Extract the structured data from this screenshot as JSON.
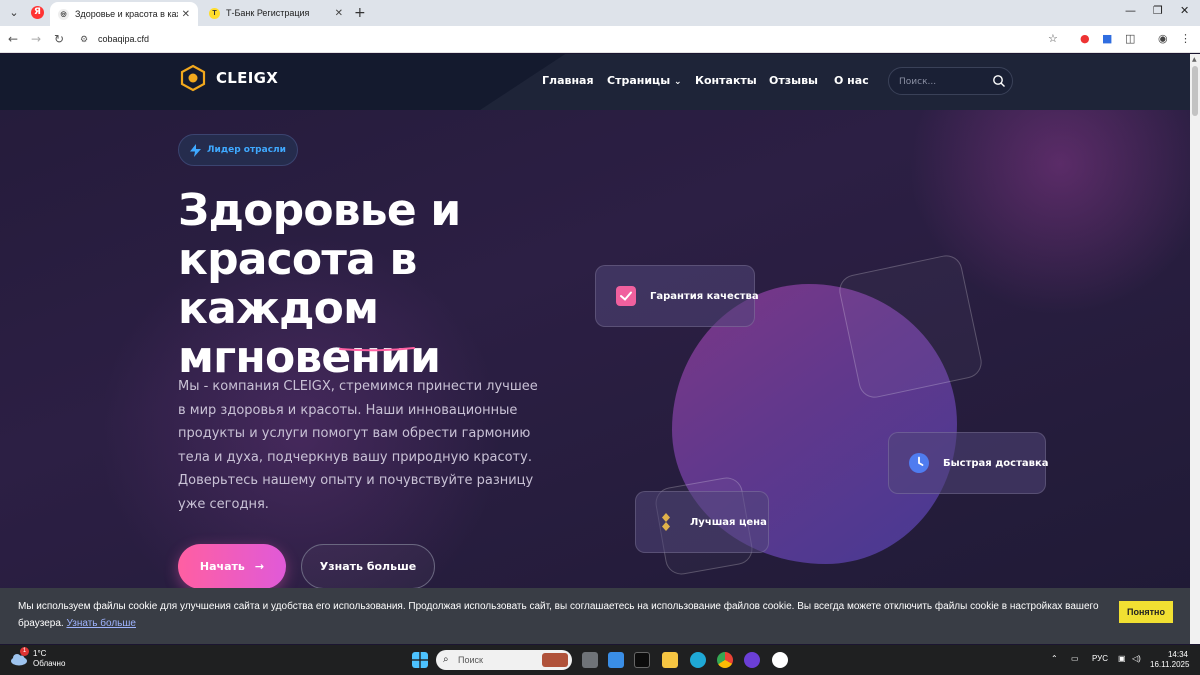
{
  "browser": {
    "tabs": [
      {
        "title": "Здоровье и красота в каждом"
      },
      {
        "title": "Т-Банк Регистрация"
      }
    ],
    "url": "cobaqipa.cfd"
  },
  "site": {
    "logo_text": "CLEIGX",
    "nav": [
      "Главная",
      "Страницы",
      "Контакты",
      "Отзывы",
      "О нас"
    ],
    "search_placeholder": "Поиск..."
  },
  "hero": {
    "badge": "Лидер отрасли",
    "title": "Здоровье и красота в каждом мгновении",
    "description": "Мы - компания CLEIGX, стремимся принести лучшее в мир здоровья и красоты. Наши инновационные продукты и услуги помогут вам обрести гармонию тела и духа, подчеркнув вашу природную красоту. Доверьтесь нашему опыту и почувствуйте разницу уже сегодня.",
    "btn_start": "Начать",
    "btn_more": "Узнать больше"
  },
  "features": [
    {
      "label": "Гарантия качества",
      "icon": "check-icon",
      "color": "#f0609e"
    },
    {
      "label": "Быстрая доставка",
      "icon": "clock-icon",
      "color": "#4f7cf0"
    },
    {
      "label": "Лучшая цена",
      "icon": "diamond-icon",
      "color": "#e0b14a"
    }
  ],
  "cookie": {
    "text": "Мы используем файлы cookie для улучшения сайта и удобства его использования. Продолжая использовать сайт, вы соглашаетесь на использование файлов cookie. Вы всегда можете отключить файлы cookie в настройках вашего браузера.",
    "link": "Узнать больше",
    "button": "Понятно"
  },
  "taskbar": {
    "temp": "1°C",
    "weather": "Облачно",
    "search_placeholder": "Поиск",
    "lang": "РУС",
    "time": "14:34",
    "date": "16.11.2025",
    "notification_count": "1"
  }
}
